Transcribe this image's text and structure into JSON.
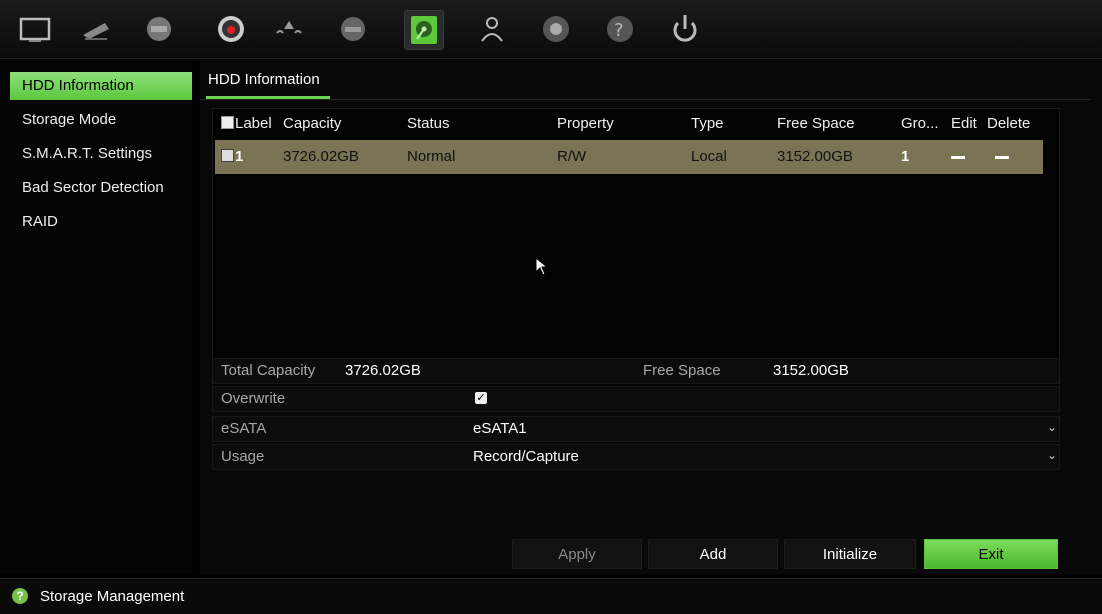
{
  "toolbar": {
    "icons": [
      "display-icon",
      "camera-icon",
      "network-icon",
      "record-icon",
      "alarm-icon",
      "device-icon",
      "storage-icon",
      "user-icon",
      "system-icon",
      "help-icon",
      "power-icon"
    ],
    "active": "storage-icon"
  },
  "sidebar": {
    "items": [
      {
        "label": "HDD Information",
        "selected": true
      },
      {
        "label": "Storage Mode"
      },
      {
        "label": "S.M.A.R.T. Settings"
      },
      {
        "label": "Bad Sector Detection"
      },
      {
        "label": "RAID"
      }
    ]
  },
  "main": {
    "tab": "HDD Information",
    "table": {
      "headers": [
        "Label",
        "Capacity",
        "Status",
        "Property",
        "Type",
        "Free Space",
        "Gro...",
        "Edit",
        "Delete"
      ],
      "rows": [
        {
          "label": "1",
          "capacity": "3726.02GB",
          "status": "Normal",
          "property": "R/W",
          "type": "Local",
          "free_space": "3152.00GB",
          "group": "1"
        }
      ]
    },
    "total_capacity_label": "Total Capacity",
    "total_capacity_value": "3726.02GB",
    "free_space_label": "Free Space",
    "free_space_value": "3152.00GB",
    "overwrite_label": "Overwrite",
    "overwrite_checked": true,
    "esata_label": "eSATA",
    "esata_value": "eSATA1",
    "usage_label": "Usage",
    "usage_value": "Record/Capture",
    "buttons": {
      "apply": "Apply",
      "add": "Add",
      "initialize": "Initialize",
      "exit": "Exit"
    }
  },
  "status": {
    "text": "Storage Management"
  },
  "colors": {
    "accent": "#6cd250",
    "row_highlight": "#7a7455"
  }
}
